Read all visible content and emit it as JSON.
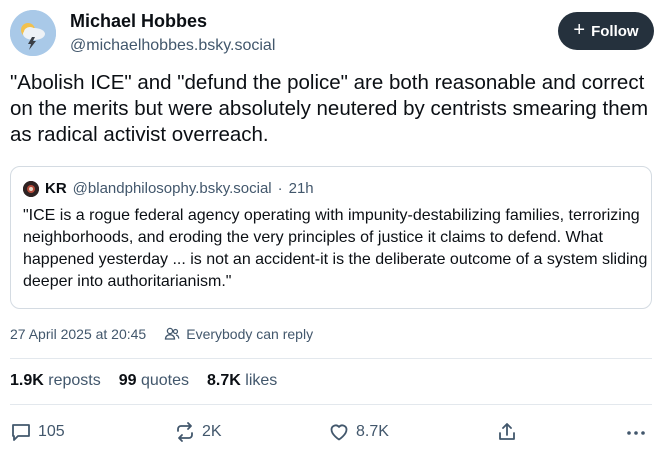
{
  "author": {
    "name": "Michael Hobbes",
    "handle": "@michaelhobbes.bsky.social"
  },
  "follow_button": {
    "label": "Follow",
    "icon": "plus-icon"
  },
  "post": {
    "text": "\"Abolish ICE\" and \"defund the police\" are both reasonable and correct on the merits but were absolutely neutered by centrists smearing them as radical activist overreach."
  },
  "quote": {
    "name": "KR",
    "handle": "@blandphilosophy.bsky.social",
    "separator": "·",
    "time": "21h",
    "text": "\"ICE is a rogue federal agency operating with impunity-destabilizing families, terrorizing neighborhoods, and eroding the very principles of justice it claims to defend. What happened yesterday ... is not an accident-it is the deliberate outcome of a system sliding deeper into authoritarianism.\""
  },
  "meta": {
    "timestamp": "27 April 2025 at 20:45",
    "reply_setting": "Everybody can reply"
  },
  "stats": {
    "reposts_count": "1.9K",
    "reposts_label": "reposts",
    "quotes_count": "99",
    "quotes_label": "quotes",
    "likes_count": "8.7K",
    "likes_label": "likes"
  },
  "actions": {
    "reply_count": "105",
    "repost_count": "2K",
    "like_count": "8.7K"
  },
  "colors": {
    "text": "#0b0f14",
    "muted": "#42576c",
    "follow_bg": "#25313d",
    "border": "#d4dbe2"
  }
}
